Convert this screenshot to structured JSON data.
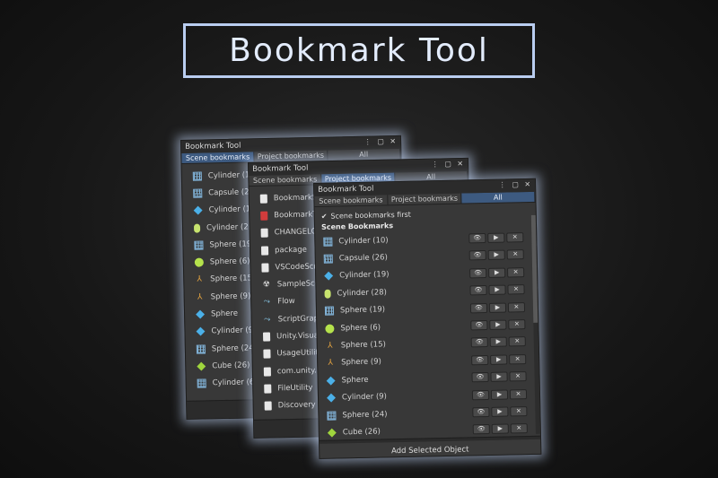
{
  "banner_title": "Bookmark Tool",
  "window_title": "Bookmark Tool",
  "window_controls": "⋮ ▢ ✕",
  "tabs": [
    {
      "label": "Scene bookmarks"
    },
    {
      "label": "Project bookmarks"
    },
    {
      "label": "All"
    }
  ],
  "win1": {
    "active_tab": 0,
    "items": [
      {
        "label": "Cylinder (1",
        "icon": "grid-icon"
      },
      {
        "label": "Capsule (2",
        "icon": "grid-icon"
      },
      {
        "label": "Cylinder (1",
        "icon": "cube-icon"
      },
      {
        "label": "Cylinder (2",
        "icon": "capsule-icon"
      },
      {
        "label": "Sphere (19)",
        "icon": "grid-icon"
      },
      {
        "label": "Sphere (6)",
        "icon": "sphere-icon"
      },
      {
        "label": "Sphere (15)",
        "icon": "tripod-icon"
      },
      {
        "label": "Sphere (9)",
        "icon": "tripod-icon"
      },
      {
        "label": "Sphere",
        "icon": "cube-icon"
      },
      {
        "label": "Cylinder (9",
        "icon": "cube-icon"
      },
      {
        "label": "Sphere (24)",
        "icon": "grid-icon"
      },
      {
        "label": "Cube (26)",
        "icon": "cube-green-icon"
      },
      {
        "label": "Cylinder (6",
        "icon": "grid-icon"
      }
    ]
  },
  "win2": {
    "active_tab": 1,
    "items": [
      {
        "label": "BookmarkS",
        "icon": "document-icon"
      },
      {
        "label": "BookmarkT",
        "icon": "document-red-icon"
      },
      {
        "label": "CHANGELO",
        "icon": "document-icon"
      },
      {
        "label": "package",
        "icon": "document-icon"
      },
      {
        "label": "VSCodeScr",
        "icon": "document-icon"
      },
      {
        "label": "SampleSce",
        "icon": "unity-icon"
      },
      {
        "label": "Flow",
        "icon": "flow-icon"
      },
      {
        "label": "ScriptGraph",
        "icon": "flow-icon"
      },
      {
        "label": "Unity.Visua",
        "icon": "document-icon"
      },
      {
        "label": "UsageUtilit",
        "icon": "document-icon"
      },
      {
        "label": "com.unity.",
        "icon": "document-icon"
      },
      {
        "label": "FileUtility",
        "icon": "document-icon"
      },
      {
        "label": "Discovery",
        "icon": "document-icon"
      }
    ]
  },
  "win3": {
    "active_tab": 2,
    "toggle_label": "Scene bookmarks first",
    "section_label": "Scene Bookmarks",
    "action_labels": {
      "view": "👁",
      "select": "▶",
      "remove": "✕"
    },
    "items": [
      {
        "label": "Cylinder (10)",
        "icon": "grid-icon"
      },
      {
        "label": "Capsule (26)",
        "icon": "grid-icon"
      },
      {
        "label": "Cylinder (19)",
        "icon": "cube-icon"
      },
      {
        "label": "Cylinder (28)",
        "icon": "capsule-icon"
      },
      {
        "label": "Sphere (19)",
        "icon": "grid-icon"
      },
      {
        "label": "Sphere (6)",
        "icon": "sphere-icon"
      },
      {
        "label": "Sphere (15)",
        "icon": "tripod-icon"
      },
      {
        "label": "Sphere (9)",
        "icon": "tripod-icon"
      },
      {
        "label": "Sphere",
        "icon": "cube-icon"
      },
      {
        "label": "Cylinder (9)",
        "icon": "cube-icon"
      },
      {
        "label": "Sphere (24)",
        "icon": "grid-icon"
      },
      {
        "label": "Cube (26)",
        "icon": "cube-green-icon"
      }
    ],
    "add_button": "Add Selected Object"
  }
}
